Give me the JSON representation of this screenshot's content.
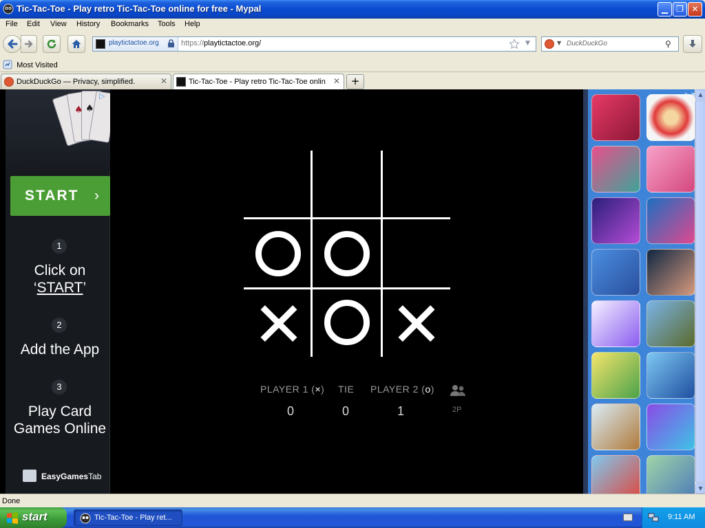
{
  "window": {
    "title": "Tic-Tac-Toe - Play retro Tic-Tac-Toe online for free - Mypal"
  },
  "menubar": {
    "items": [
      "File",
      "Edit",
      "View",
      "History",
      "Bookmarks",
      "Tools",
      "Help"
    ]
  },
  "navbar": {
    "identity_host": "playtictactoe.org",
    "url_scheme": "https://",
    "url_rest": "playtictactoe.org/",
    "search_placeholder": "DuckDuckGo"
  },
  "bookmarks": {
    "most_visited": "Most Visited"
  },
  "tabs": [
    {
      "label": "DuckDuckGo — Privacy, simplified.",
      "active": false
    },
    {
      "label": "Tic-Tac-Toe - Play retro Tic-Tac-Toe onlin...",
      "active": true
    }
  ],
  "left_ad": {
    "start_label": "START",
    "start_chevron": "›",
    "steps": [
      {
        "num": "1",
        "line1": "Click on",
        "quote_open": "‘",
        "link": "START",
        "quote_close": "’"
      },
      {
        "num": "2",
        "line1": "Add the App"
      },
      {
        "num": "3",
        "line1": "Play Card",
        "line2": "Games Online"
      }
    ],
    "brand_bold": "EasyGames",
    "brand_light": "Tab"
  },
  "board": {
    "cells": [
      "",
      "",
      "",
      "O",
      "O",
      "",
      "X",
      "O",
      "X"
    ]
  },
  "score": {
    "player1_label": "PLAYER 1",
    "player1_symbol": "×",
    "tie_label": "TIE",
    "player2_label": "PLAYER 2",
    "player2_symbol": "o",
    "player1_score": "0",
    "tie_score": "0",
    "player2_score": "1",
    "mode_label": "2P",
    "mode_icon": "two-people-icon"
  },
  "status": {
    "text": "Done"
  },
  "taskbar": {
    "start_label": "start",
    "task_label": "Tic-Tac-Toe - Play ret...",
    "clock": "9:11 AM"
  },
  "colors": {
    "start_green": "#4b9e35",
    "titlebar_blue": "#0a4ad0",
    "games_panel_blue": "#3e84d9"
  }
}
